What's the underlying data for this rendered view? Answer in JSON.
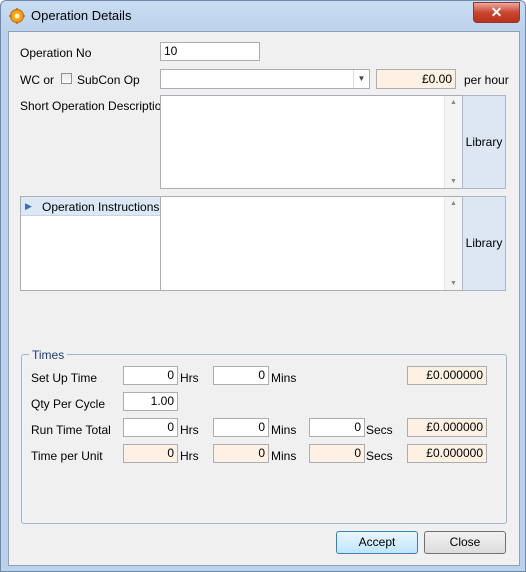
{
  "window": {
    "title": "Operation Details",
    "close_glyph": "✕"
  },
  "form": {
    "operation_no_label": "Operation No",
    "operation_no_value": "10",
    "wc_or_label": "WC or",
    "subcon_label": "SubCon Op",
    "rate_value": "£0.00",
    "per_hour_label": "per hour",
    "short_desc_label": "Short Operation Description",
    "library_label": "Library",
    "op_instructions_label": "Operation Instructions"
  },
  "times": {
    "group_label": "Times",
    "set_up_time_label": "Set Up Time",
    "qty_per_cycle_label": "Qty Per Cycle",
    "run_time_total_label": "Run Time Total",
    "time_per_unit_label": "Time per Unit",
    "hrs_label": "Hrs",
    "mins_label": "Mins",
    "secs_label": "Secs",
    "setup_hrs": "0",
    "setup_mins": "0",
    "setup_cost": "£0.000000",
    "qty_per_cycle": "1.00",
    "run_hrs": "0",
    "run_mins": "0",
    "run_secs": "0",
    "run_cost": "£0.000000",
    "unit_hrs": "0",
    "unit_mins": "0",
    "unit_secs": "0",
    "unit_cost": "£0.000000"
  },
  "buttons": {
    "accept": "Accept",
    "close": "Close"
  },
  "icons": {
    "app": "gear-icon",
    "scroll_up": "scroll-up-arrow-icon",
    "scroll_down": "scroll-down-arrow-icon",
    "row_pointer": "row-pointer-icon",
    "dropdown": "chevron-down-icon"
  }
}
